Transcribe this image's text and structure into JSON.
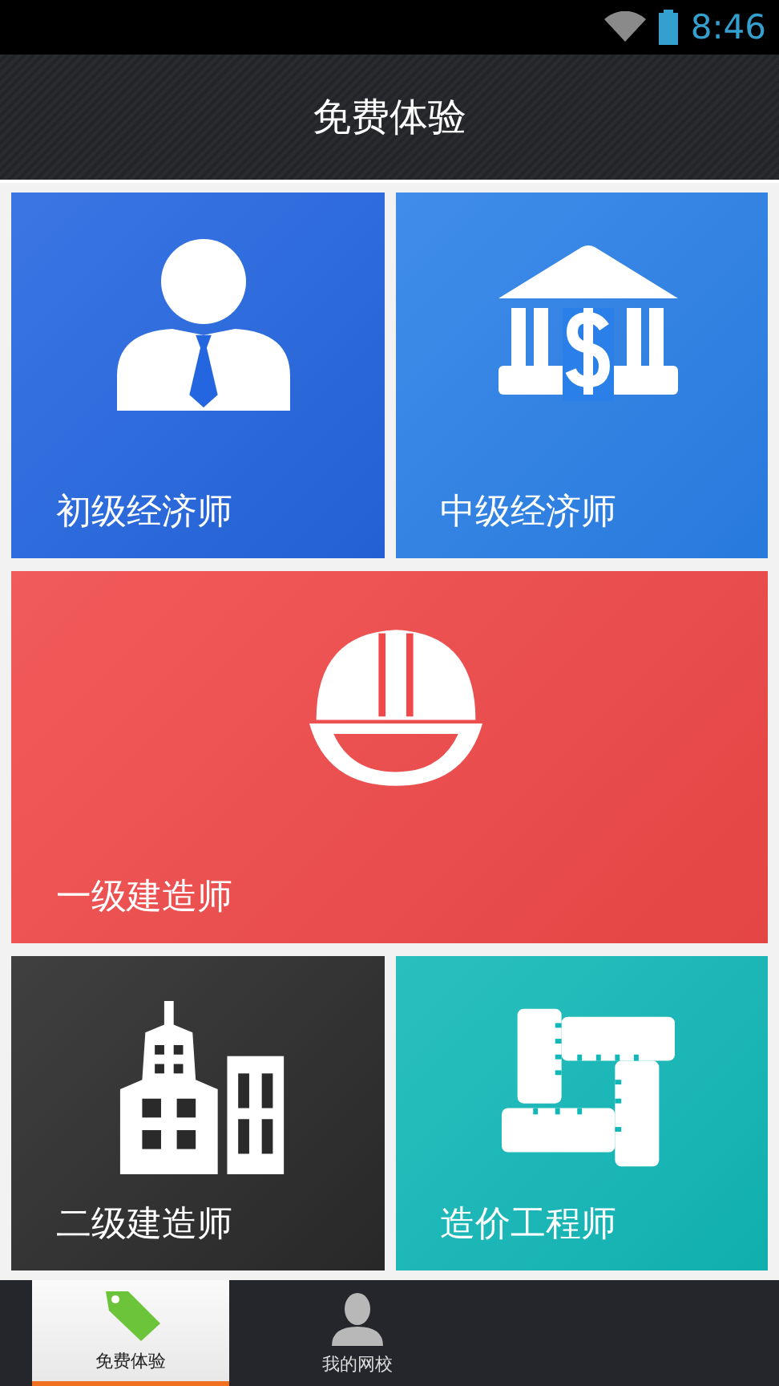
{
  "status_bar": {
    "time": "8:46"
  },
  "header": {
    "title": "免费体验"
  },
  "tiles": [
    {
      "label": "初级经济师",
      "kind": "person",
      "color": "#2466e0",
      "wide": false
    },
    {
      "label": "中级经济师",
      "kind": "bank",
      "color": "#2a80e8",
      "wide": false
    },
    {
      "label": "一级建造师",
      "kind": "helmet",
      "color": "#f04848",
      "wide": true
    },
    {
      "label": "二级建造师",
      "kind": "buildings",
      "color": "#2a2a2a",
      "wide": false
    },
    {
      "label": "造价工程师",
      "kind": "rulers",
      "color": "#12b8b8",
      "wide": false
    }
  ],
  "tabs": [
    {
      "label": "免费体验",
      "kind": "tag",
      "selected": true
    },
    {
      "label": "我的网校",
      "kind": "person",
      "selected": false
    }
  ]
}
